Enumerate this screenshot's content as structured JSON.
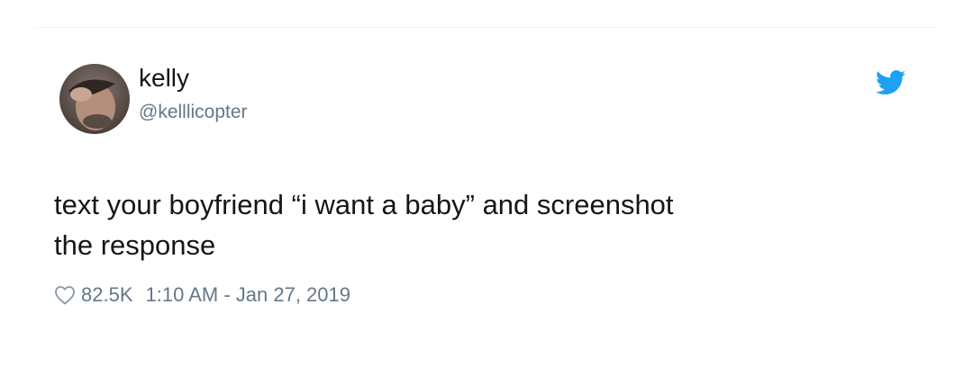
{
  "tweet": {
    "author": {
      "display_name": "kelly",
      "handle": "@kelllicopter",
      "avatar_icon": "profile-photo"
    },
    "brand_icon": "twitter-bird-icon",
    "brand_color": "#1da1f2",
    "text": "text your boyfriend “i want a baby” and screenshot\nthe response",
    "likes": "82.5K",
    "like_icon": "heart-outline-icon",
    "timestamp": "1:10 AM - Jan 27, 2019"
  }
}
